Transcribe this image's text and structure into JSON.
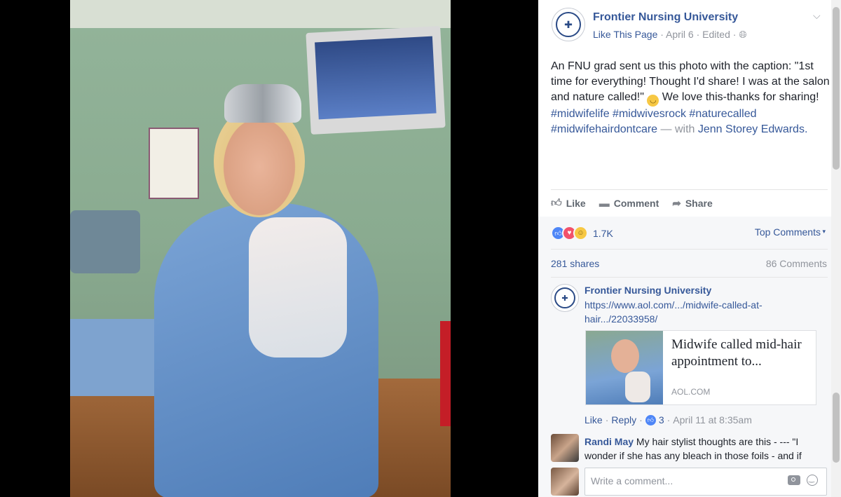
{
  "post": {
    "page_name": "Frontier Nursing University",
    "like_page": "Like This Page",
    "date": "April 6",
    "edited": "Edited",
    "text_line1": "An FNU grad sent us this photo with the caption: \"1st time for everything! Thought I'd share! I was at the salon and nature called!\" ",
    "text_line2": " We love this-thanks for sharing!",
    "hashtags_1": "#midwifelife #midwivesrock #natureCalled",
    "hashtag_a": "#midwifelife",
    "hashtag_b": "#midwivesrock",
    "hashtag_c": "#naturecalled",
    "hashtag_d": "#midwifehairdontcare",
    "with_text": " — with ",
    "tagged_person": "Jenn Storey Edwards."
  },
  "actions": {
    "like": "Like",
    "comment": "Comment",
    "share": "Share"
  },
  "feedback": {
    "reaction_count": "1.7K",
    "top_comments": "Top Comments",
    "shares": "281 shares",
    "comments": "86 Comments"
  },
  "comment1": {
    "author": "Frontier Nursing University",
    "link": "https://www.aol.com/.../midwife-called-at-hair.../22033958/",
    "card_title": "Midwife called mid-hair appointment to...",
    "card_domain": "AOL.COM",
    "like": "Like",
    "reply": "Reply",
    "like_count": "3",
    "date": "April 11 at 8:35am"
  },
  "comment2": {
    "author": "Randi May",
    "text": " My hair stylist thoughts are this - --- \"I wonder if she has any bleach in those foils - and if"
  },
  "composer": {
    "placeholder": "Write a comment..."
  }
}
